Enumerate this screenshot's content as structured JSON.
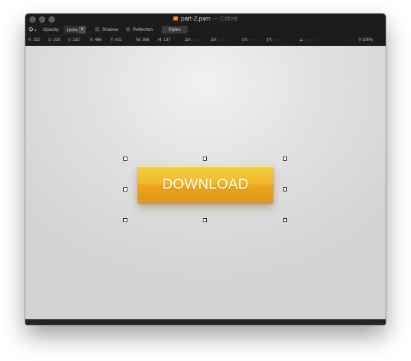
{
  "window": {
    "title": "part-2.pxm",
    "separator": "—",
    "status": "Edited"
  },
  "toolbar": {
    "opacity_label": "Opacity:",
    "opacity_value": "100%",
    "shadow_label": "Shadow",
    "reflection_label": "Reflection",
    "styles_label": "Styles"
  },
  "infobar": {
    "r_label": "R:",
    "r_value": "210",
    "g_label": "G:",
    "g_value": "210",
    "b_label": "B:",
    "b_value": "210",
    "x_label": "X:",
    "x_value": "466",
    "y_label": "Y:",
    "y_value": "431",
    "w_label": "W:",
    "w_value": "356",
    "h_label": "H:",
    "h_value": "137",
    "dx_label": "ΔX:",
    "dx_value": "------",
    "dy_label": "ΔY:",
    "dy_value": "------",
    "cx_label": "‡X:",
    "cx_value": "------",
    "cy_label": "‡Y:",
    "cy_value": "------",
    "angle_label": "∡:",
    "angle_value": "--------",
    "zoom_value": "100%"
  },
  "canvas": {
    "button_label": "DOWNLOAD"
  },
  "icons": {
    "gear": "gear-icon",
    "doc": "document-icon",
    "zoom": "magnifier-icon"
  },
  "colors": {
    "button_top": "#f5cf45",
    "button_bottom": "#e39519",
    "label_r": "#e55b4d",
    "label_g": "#5fbf4a",
    "label_b": "#4b8fe0"
  }
}
